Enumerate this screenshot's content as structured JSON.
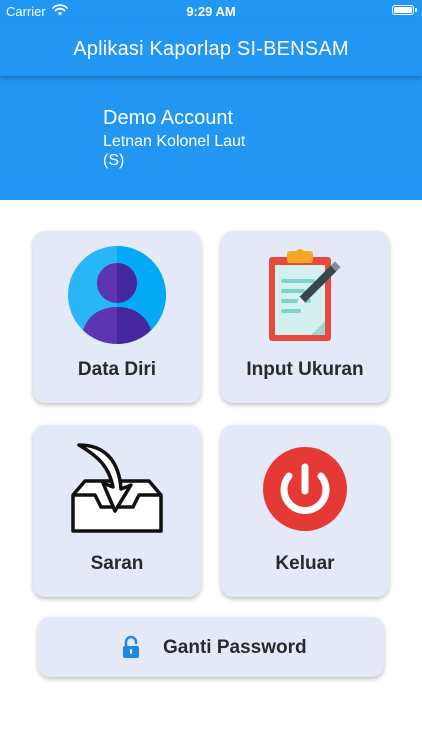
{
  "status_bar": {
    "carrier": "Carrier",
    "time": "9:29 AM"
  },
  "app_bar": {
    "title": "Aplikasi Kaporlap SI-BENSAM"
  },
  "profile": {
    "name": "Demo Account",
    "rank": "Letnan Kolonel Laut (S)"
  },
  "menu": {
    "data_diri": {
      "label": "Data Diri",
      "icon": "user-avatar-icon"
    },
    "input_ukuran": {
      "label": "Input Ukuran",
      "icon": "clipboard-pencil-icon"
    },
    "saran": {
      "label": "Saran",
      "icon": "inbox-arrow-icon"
    },
    "keluar": {
      "label": "Keluar",
      "icon": "power-icon"
    }
  },
  "password_button": {
    "label": "Ganti Password",
    "icon": "lock-icon"
  },
  "colors": {
    "primary": "#2196f3",
    "tile_bg": "#e4e9f7",
    "power_red": "#e53935",
    "lock_blue": "#1e88e5"
  }
}
